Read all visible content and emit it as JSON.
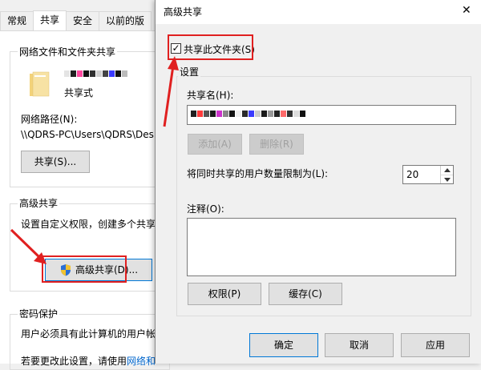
{
  "bg": {
    "tabs": [
      "常规",
      "共享",
      "安全",
      "以前的版"
    ],
    "network_group_title": "网络文件和文件夹共享",
    "folder_status": "共享式",
    "network_path_label": "网络路径(N):",
    "network_path_value": "\\\\QDRS-PC\\Users\\QDRS\\Des",
    "share_button": "共享(S)...",
    "advanced_group_title": "高级共享",
    "advanced_desc": "设置自定义权限，创建多个共享",
    "advanced_button": "高级共享(D)...",
    "password_group_title": "密码保护",
    "password_desc": "用户必须具有此计算机的用户帐",
    "password_desc2_a": "若要更改此设置，请使用",
    "password_desc2_link": "网络和"
  },
  "dialog": {
    "title": "高级共享",
    "close_glyph": "✕",
    "share_checkbox_label": "共享此文件夹(S)",
    "settings_title": "设置",
    "share_name_label": "共享名(H):",
    "add_button": "添加(A)",
    "remove_button": "删除(R)",
    "user_limit_label": "将同时共享的用户数量限制为(L):",
    "user_limit_value": "20",
    "comment_label": "注释(O):",
    "permissions_button": "权限(P)",
    "caching_button": "缓存(C)",
    "ok_button": "确定",
    "cancel_button": "取消",
    "apply_button": "应用"
  },
  "colors": {
    "accent_red": "#e02020",
    "focus_blue": "#0078d7",
    "link_blue": "#0066cc"
  }
}
